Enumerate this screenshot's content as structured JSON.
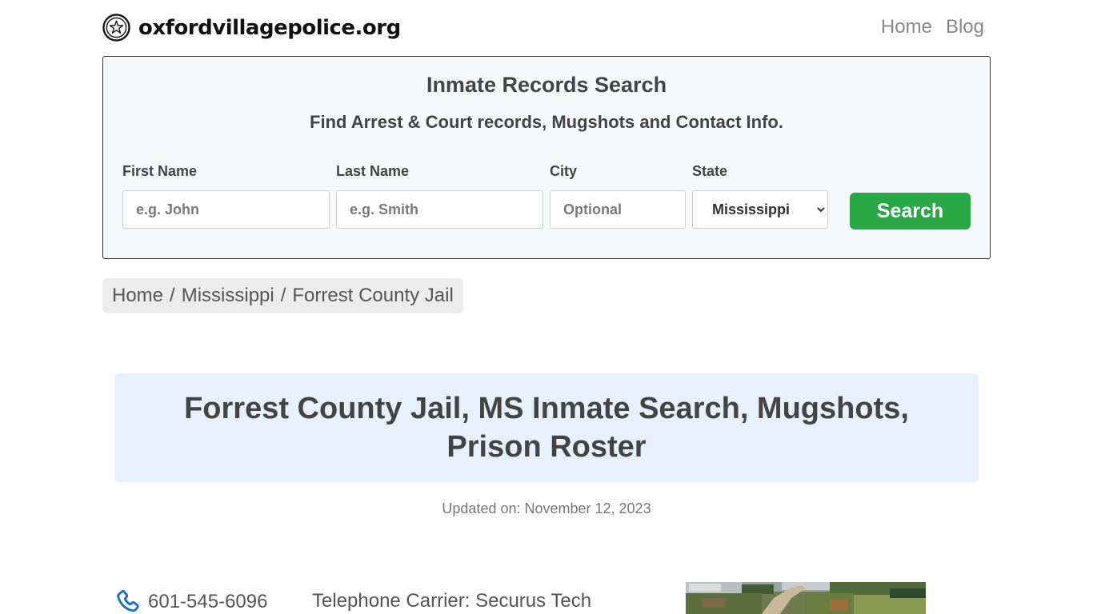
{
  "header": {
    "site_name": "oxfordvillagepolice.org",
    "logo_icon": "police-badge-star-icon",
    "nav": [
      {
        "label": "Home"
      },
      {
        "label": "Blog"
      }
    ]
  },
  "search_form": {
    "title": "Inmate Records Search",
    "subtitle": "Find Arrest & Court records, Mugshots and Contact Info.",
    "first_name": {
      "label": "First Name",
      "placeholder": "e.g. John",
      "value": ""
    },
    "last_name": {
      "label": "Last Name",
      "placeholder": "e.g. Smith",
      "value": ""
    },
    "city": {
      "label": "City",
      "placeholder": "Optional",
      "value": ""
    },
    "state": {
      "label": "State",
      "selected": "Mississippi"
    },
    "submit_label": "Search",
    "submit_color": "#28a745"
  },
  "breadcrumb": {
    "items": [
      "Home",
      "Mississippi",
      "Forrest County Jail"
    ],
    "separator": "/"
  },
  "page_title": "Forrest County Jail, MS Inmate Search, Mugshots, Prison Roster",
  "updated": "Updated on: November 12, 2023",
  "contact": {
    "phone_icon": "phone-icon",
    "phone": "601-545-6096",
    "carrier": "Telephone Carrier: Securus Tech"
  },
  "colors": {
    "title_bg": "#e7f0fd",
    "phone_icon": "#1a6fc4"
  }
}
